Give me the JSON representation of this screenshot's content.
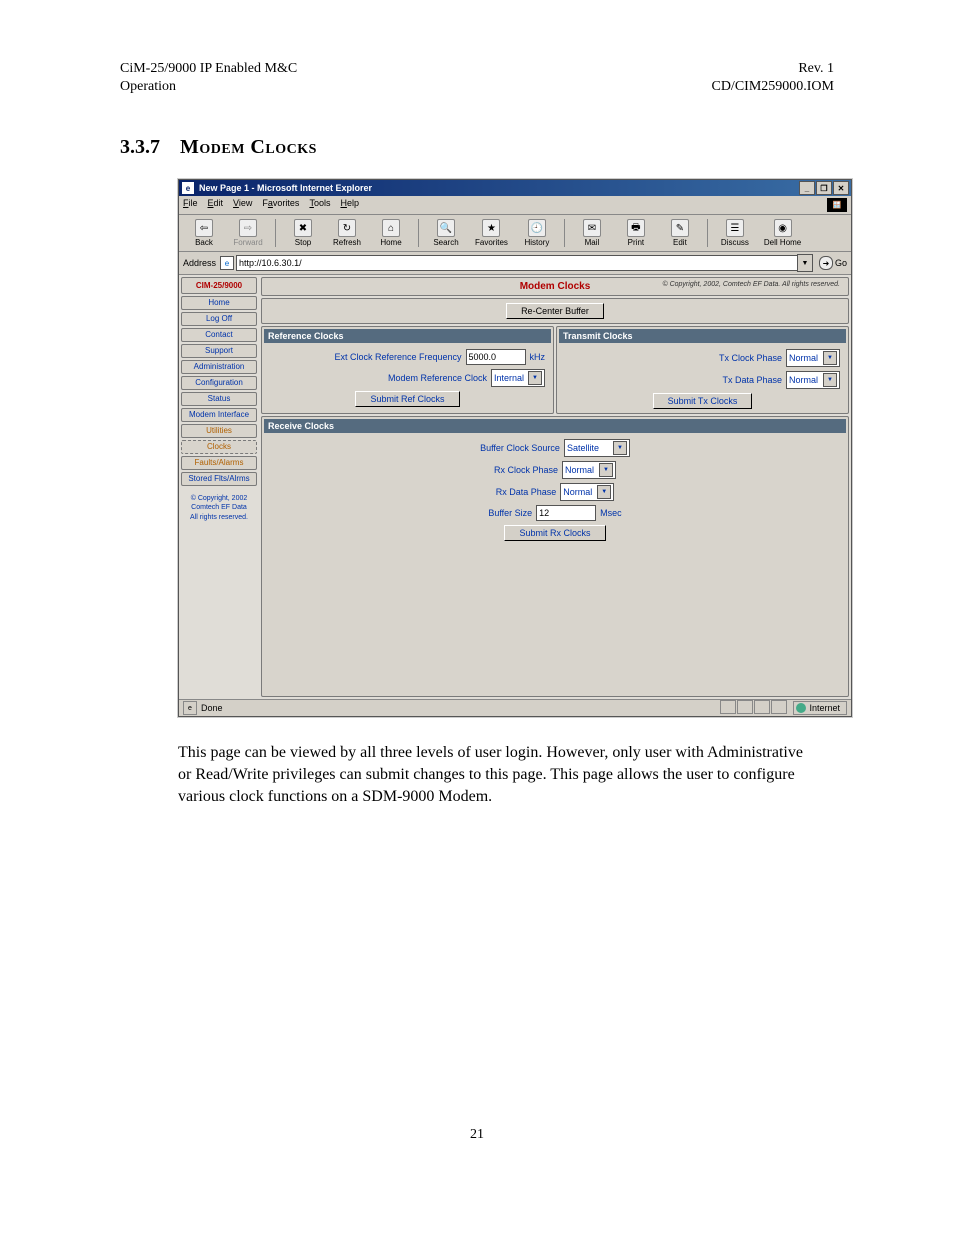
{
  "doc": {
    "hl1": "CiM-25/9000 IP Enabled M&C",
    "hl2": "Operation",
    "hr1": "Rev. 1",
    "hr2": "CD/CIM259000.IOM",
    "section_num": "3.3.7",
    "section_title": "Modem Clocks",
    "body": "This page can be viewed by all three levels of user login.  However, only user with Administrative or Read/Write privileges can submit changes to this page.  This page allows the user to configure various clock functions on a SDM-9000 Modem.",
    "page": "21"
  },
  "win": {
    "title": "New Page 1 - Microsoft Internet Explorer",
    "menu": [
      "File",
      "Edit",
      "View",
      "Favorites",
      "Tools",
      "Help"
    ],
    "toolbar": [
      "Back",
      "Forward",
      "Stop",
      "Refresh",
      "Home",
      "Search",
      "Favorites",
      "History",
      "Mail",
      "Print",
      "Edit",
      "Discuss",
      "Dell Home"
    ],
    "addr_label": "Address",
    "addr_value": "http://10.6.30.1/",
    "go": "Go",
    "status": "Done",
    "zone": "Internet",
    "wbtns": [
      "_",
      "❐",
      "✕"
    ]
  },
  "side": {
    "header": "CIM-25/9000",
    "items": [
      "Home",
      "Log Off",
      "Contact",
      "Support",
      "Administration",
      "Configuration",
      "Status",
      "Modem Interface",
      "Utilities",
      "Clocks",
      "Faults/Alarms",
      "Stored Flts/Alrms"
    ],
    "foot1": "© Copyright, 2002",
    "foot2": "Comtech EF Data",
    "foot3": "All rights reserved."
  },
  "page": {
    "title": "Modem Clocks",
    "copyright": "© Copyright, 2002, Comtech EF Data. All rights reserved.",
    "recenter": "Re-Center Buffer",
    "ref": {
      "h": "Reference Clocks",
      "l1": "Ext Clock Reference Frequency",
      "v1": "5000.0",
      "u1": "kHz",
      "l2": "Modem Reference Clock",
      "v2": "Internal",
      "btn": "Submit Ref Clocks"
    },
    "tx": {
      "h": "Transmit Clocks",
      "l1": "Tx Clock Phase",
      "v1": "Normal",
      "l2": "Tx Data Phase",
      "v2": "Normal",
      "btn": "Submit Tx Clocks"
    },
    "rx": {
      "h": "Receive Clocks",
      "l1": "Buffer Clock Source",
      "v1": "Satellite",
      "l2": "Rx Clock Phase",
      "v2": "Normal",
      "l3": "Rx Data Phase",
      "v3": "Normal",
      "l4": "Buffer Size",
      "v4": "12",
      "u4": "Msec",
      "btn": "Submit Rx Clocks"
    }
  }
}
